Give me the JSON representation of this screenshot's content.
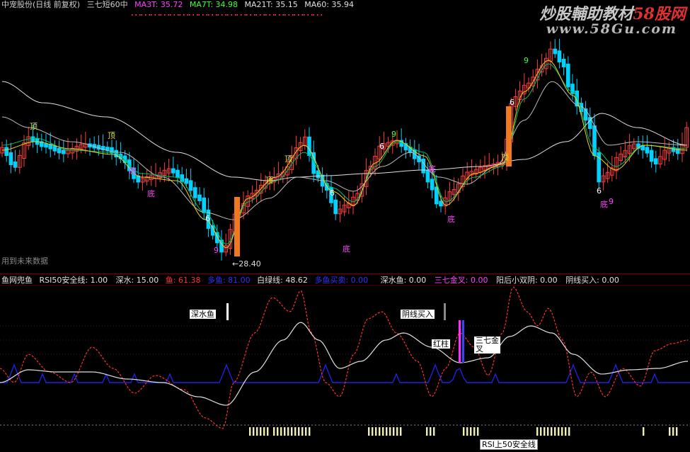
{
  "header": {
    "stock": "中宠股份(日线 前复权)",
    "indicator": "三七短60中",
    "ma3_label": "MA3T: 35.72",
    "ma7_label": "MA7T: 34.98",
    "ma21_label": "MA21T: 35.15",
    "ma60_label": "MA60: 35.94"
  },
  "watermark": {
    "text": "炒股輔助教材",
    "brand": "58股网",
    "url": "www.58Gu.com"
  },
  "main_chart": {
    "future_note": "用到未来数据",
    "low_price_label": "←28.40",
    "signals": {
      "ding": "顶",
      "di": "底",
      "nine": "9",
      "six": "6"
    },
    "colors": {
      "up": "#ff3c3c",
      "down": "#00d2ff",
      "ma_white": "#e0e0e0",
      "ma_green": "#00c060",
      "ma_yellow": "#f0d020",
      "orange_bar": "#f07820",
      "signal_yellow": "#e0e020",
      "signal_magenta": "#ff40ff",
      "signal_green": "#40ff40"
    }
  },
  "indicator_header": {
    "name": "鱼网兜鱼",
    "rsi50": "RSI50安全线: 1.00",
    "deep_water": "深水: 15.00",
    "fish": "鱼: 61.38",
    "multi_fish": "多鱼: 81.00",
    "white_green": "白绿线: 48.62",
    "multi_cross": "多鱼买卖: 0.00",
    "deep_fish": "深水鱼: 0.00",
    "gold_cross": "三七金叉: 0.00",
    "yang_yin": "阳后小双阴: 0.00",
    "yin_buy": "阴线买入: 0.00"
  },
  "indicator_labels": {
    "deep_water_fish": "深水鱼",
    "yin_buy": "阴线买入",
    "red_column": "红柱",
    "gold_cross_a": "三七金",
    "gold_cross_b": "叉",
    "rsi_safe": "RSI上50安全线"
  }
}
